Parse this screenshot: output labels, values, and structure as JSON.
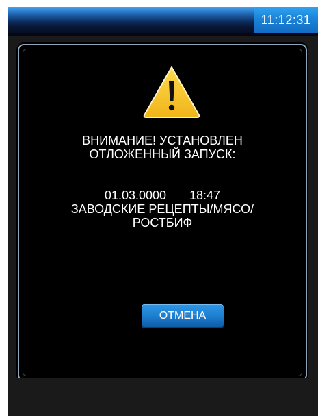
{
  "status_bar": {
    "time": "11:12:31"
  },
  "dialog": {
    "icon": "warning-icon",
    "title_line1": "ВНИМАНИЕ! УСТАНОВЛЕН",
    "title_line2": "ОТЛОЖЕННЫЙ ЗАПУСК:",
    "date": "01.03.0000",
    "time": "18:47",
    "recipe_line1": "ЗАВОДСКИЕ РЕЦЕПТЫ/МЯСО/",
    "recipe_line2": "РОСТБИФ",
    "cancel_label": "ОТМЕНА"
  },
  "colors": {
    "accent_blue": "#1d7ccd",
    "warning_yellow": "#f4c21f",
    "frame_border": "#8fa6bd"
  }
}
